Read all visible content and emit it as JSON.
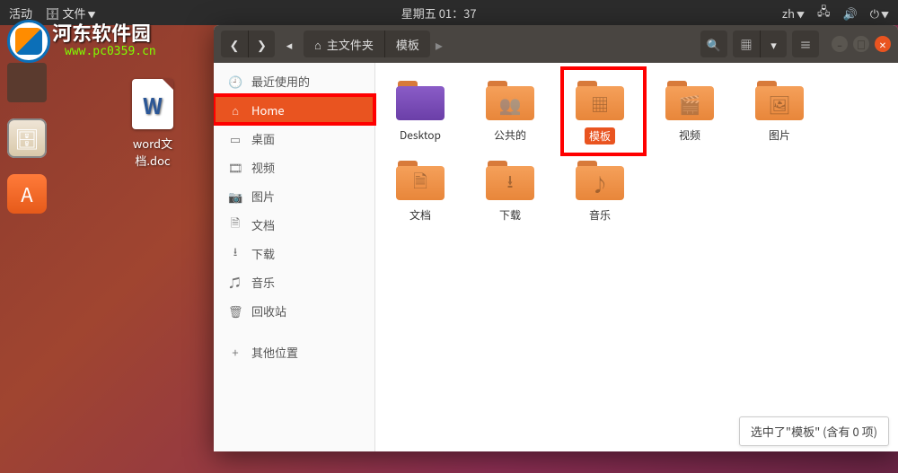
{
  "topbar": {
    "activities": "活动",
    "app_menu": "文件",
    "clock": "星期五 01：37",
    "input": "zh"
  },
  "watermark": {
    "text": "河东软件园",
    "url": "www.pc0359.cn"
  },
  "desktop": {
    "word_doc": "word文档.doc"
  },
  "dock": {
    "files": "files-app-icon",
    "software": "software-center-icon",
    "thumb": "window-thumbnail"
  },
  "window": {
    "path1": "主文件夹",
    "path2": "模板",
    "status": "选中了\"模板\" (含有 0 项)"
  },
  "sidebar": {
    "items": [
      {
        "icon": "🕘",
        "label": "最近使用的"
      },
      {
        "icon": "⌂",
        "label": "Home"
      },
      {
        "icon": "▭",
        "label": "桌面"
      },
      {
        "icon": "🎞",
        "label": "视频"
      },
      {
        "icon": "📷",
        "label": "图片"
      },
      {
        "icon": "🗎",
        "label": "文档"
      },
      {
        "icon": "⭳",
        "label": "下载"
      },
      {
        "icon": "♫",
        "label": "音乐"
      },
      {
        "icon": "🗑",
        "label": "回收站"
      }
    ],
    "other": {
      "icon": "+",
      "label": "其他位置"
    }
  },
  "folders": {
    "row1": [
      {
        "label": "Desktop",
        "variant": "desktop",
        "glyph": ""
      },
      {
        "label": "公共的",
        "glyph": "👥"
      },
      {
        "label": "模板",
        "glyph": "▦",
        "selected": true
      },
      {
        "label": "视频",
        "glyph": "🎬"
      },
      {
        "label": "图片",
        "glyph": "🖼"
      }
    ],
    "row2": [
      {
        "label": "文档",
        "glyph": "🗎"
      },
      {
        "label": "下载",
        "glyph": "⭳"
      },
      {
        "label": "音乐",
        "glyph": "♪"
      }
    ]
  }
}
